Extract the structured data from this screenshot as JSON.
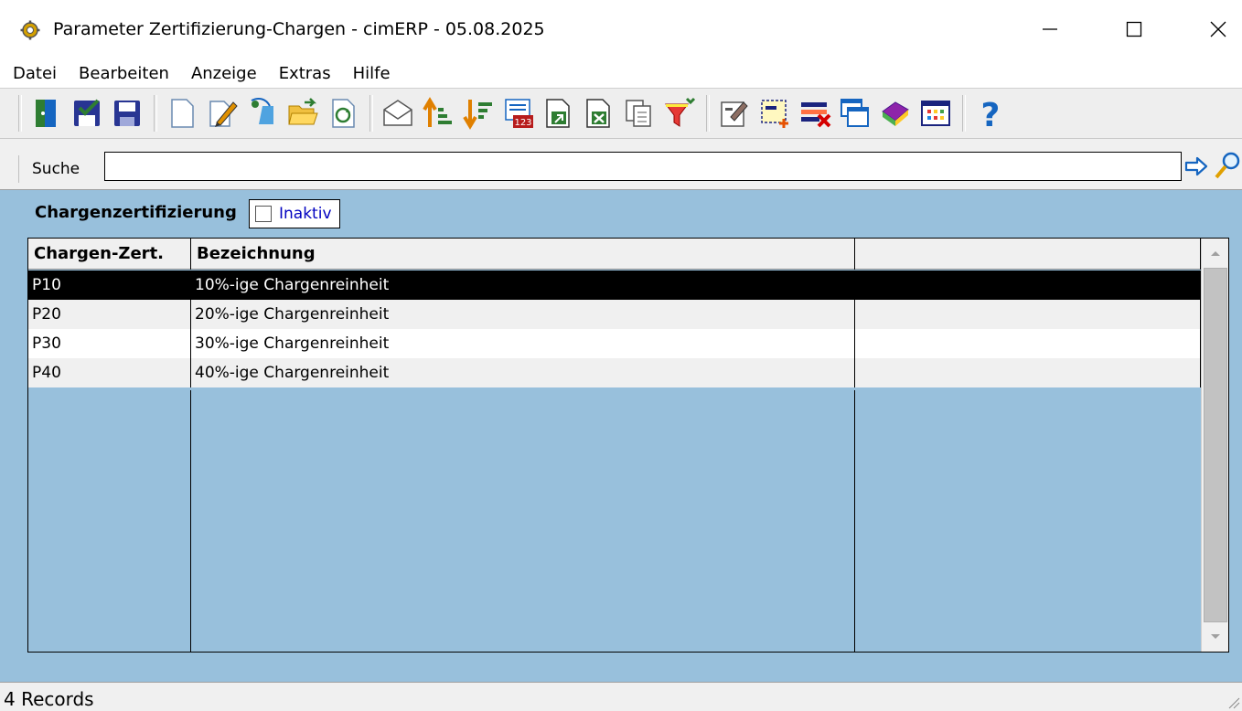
{
  "window": {
    "title": "Parameter Zertifizierung-Chargen - cimERP - 05.08.2025"
  },
  "menu": [
    "Datei",
    "Bearbeiten",
    "Anzeige",
    "Extras",
    "Hilfe"
  ],
  "search": {
    "label": "Suche",
    "value": ""
  },
  "filter": {
    "section_label": "Chargenzertifizierung",
    "inaktiv_label": "Inaktiv",
    "inaktiv_checked": false
  },
  "grid": {
    "columns": [
      "Chargen-Zert.",
      "Bezeichnung",
      ""
    ],
    "rows": [
      [
        "P10",
        "10%-ige Chargenreinheit",
        ""
      ],
      [
        "P20",
        "20%-ige Chargenreinheit",
        ""
      ],
      [
        "P30",
        "30%-ige Chargenreinheit",
        ""
      ],
      [
        "P40",
        "40%-ige Chargenreinheit",
        ""
      ]
    ],
    "selected_row": 0
  },
  "status": {
    "text": "4 Records"
  },
  "colors": {
    "panel": "#98c0dc",
    "selected": "#000000",
    "link": "#0000c0"
  }
}
